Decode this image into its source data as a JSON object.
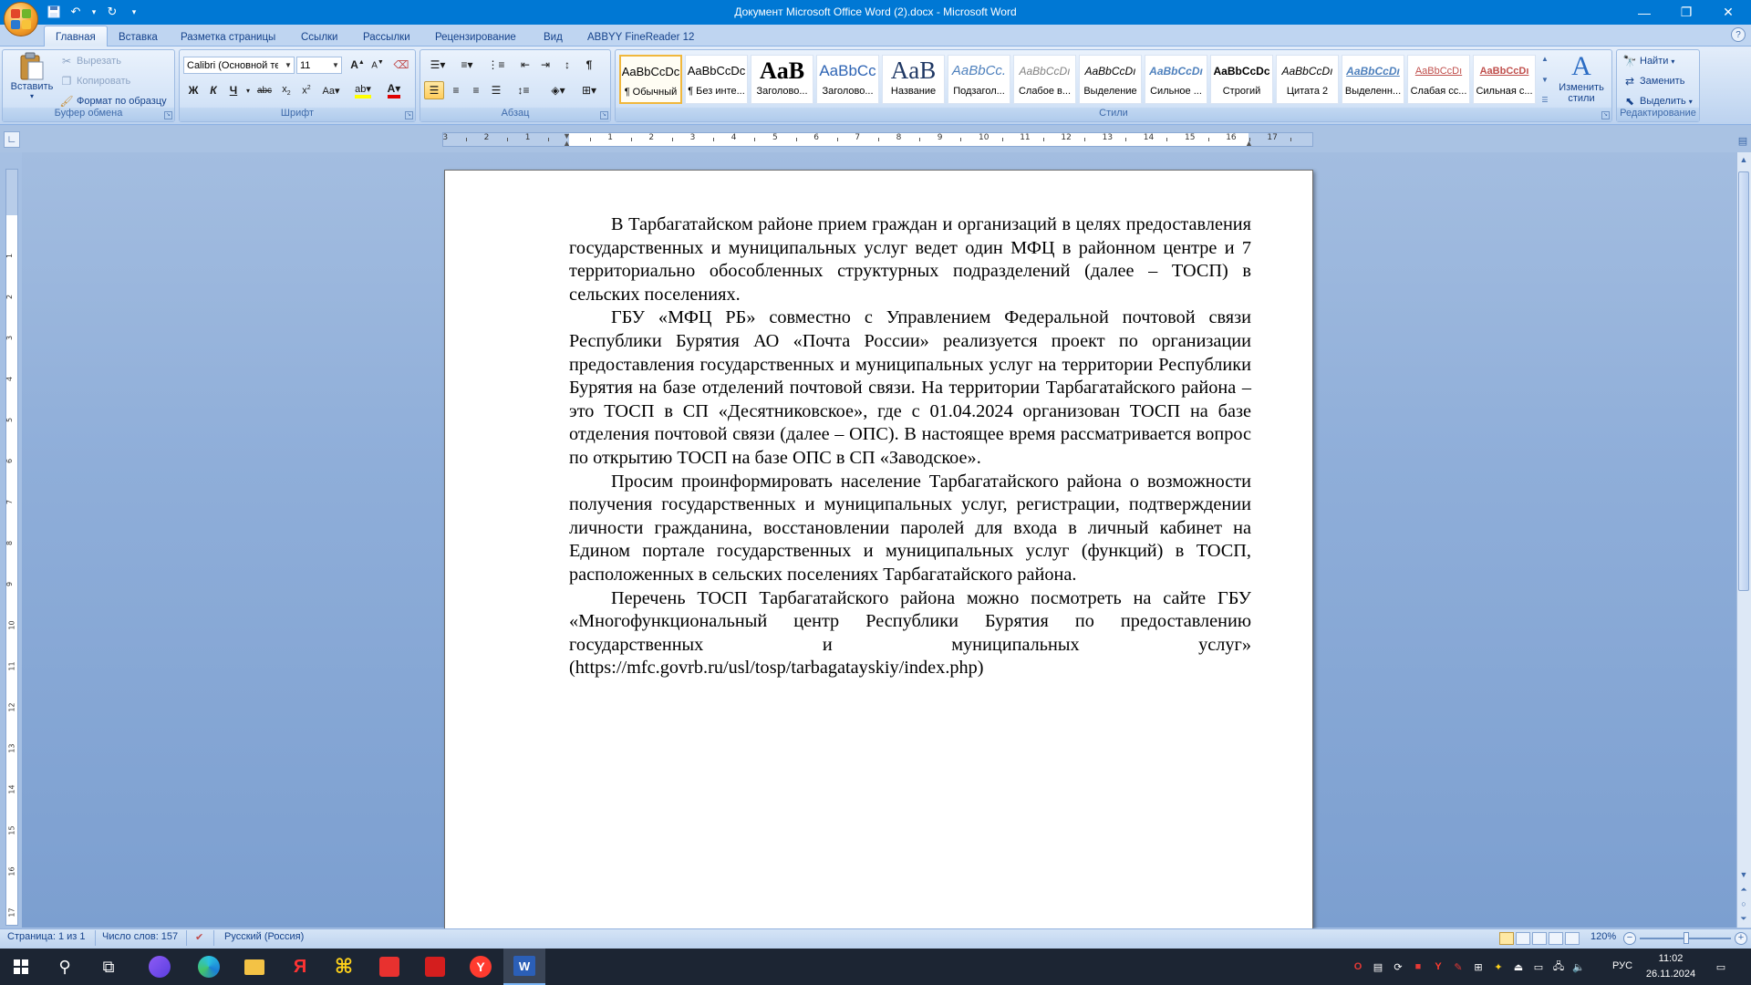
{
  "window": {
    "title": "Документ Microsoft Office Word (2).docx - Microsoft Word",
    "min_icon": "minimize-icon",
    "max_icon": "restore-icon",
    "close_icon": "close-icon"
  },
  "ribbon": {
    "tabs": [
      "Главная",
      "Вставка",
      "Разметка страницы",
      "Ссылки",
      "Рассылки",
      "Рецензирование",
      "Вид",
      "ABBYY FineReader 12"
    ],
    "active_tab": "Главная",
    "clipboard": {
      "paste": "Вставить",
      "cut": "Вырезать",
      "copy": "Копировать",
      "format_painter": "Формат по образцу",
      "title": "Буфер обмена"
    },
    "font": {
      "name": "Calibri (Основной те",
      "size": "11",
      "title": "Шрифт"
    },
    "paragraph": {
      "title": "Абзац"
    },
    "styles": {
      "title": "Стили",
      "items": [
        {
          "preview": "AaBbCcDc",
          "name": "¶ Обычный"
        },
        {
          "preview": "AaBbCcDc",
          "name": "¶ Без инте..."
        },
        {
          "preview": "AaB",
          "name": "Заголово..."
        },
        {
          "preview": "AaBbCc",
          "name": "Заголово..."
        },
        {
          "preview": "AaB",
          "name": "Название"
        },
        {
          "preview": "AaBbCc.",
          "name": "Подзагол..."
        },
        {
          "preview": "AaBbCcDı",
          "name": "Слабое в..."
        },
        {
          "preview": "AaBbCcDı",
          "name": "Выделение"
        },
        {
          "preview": "AaBbCcDı",
          "name": "Сильное ..."
        },
        {
          "preview": "AaBbCcDc",
          "name": "Строгий"
        },
        {
          "preview": "AaBbCcDı",
          "name": "Цитата 2"
        },
        {
          "preview": "AaBbCcDı",
          "name": "Выделенн..."
        },
        {
          "preview": "AaBbCcDı",
          "name": "Слабая сс..."
        },
        {
          "preview": "AaBbCcDı",
          "name": "Сильная с..."
        }
      ],
      "change_styles": "Изменить стили"
    },
    "editing": {
      "find": "Найти",
      "replace": "Заменить",
      "select": "Выделить",
      "title": "Редактирование"
    }
  },
  "ruler": {
    "h_left": [
      "3",
      "2",
      "1"
    ],
    "h_right": [
      "1",
      "2",
      "3",
      "4",
      "5",
      "6",
      "7",
      "8",
      "9",
      "10",
      "11",
      "12",
      "13",
      "14",
      "15",
      "16",
      "17"
    ],
    "v": [
      "1",
      "2",
      "3",
      "4",
      "5",
      "6",
      "7",
      "8",
      "9",
      "10",
      "11",
      "12",
      "13",
      "14",
      "15",
      "16",
      "17"
    ]
  },
  "document": {
    "paragraphs": [
      "В Тарбагатайском районе прием граждан и организаций в целях предоставления государственных и муниципальных услуг ведет один МФЦ в районном центре и 7 территориально обособленных структурных подразделений (далее – ТОСП) в сельских поселениях.",
      "ГБУ «МФЦ РБ» совместно с Управлением Федеральной почтовой связи Республики Бурятия АО «Почта России» реализуется проект по организации предоставления государственных и муниципальных услуг на территории Республики Бурятия на базе отделений почтовой связи. На территории Тарбагатайского района – это ТОСП в СП «Десятниковское», где с 01.04.2024 организован ТОСП на базе отделения почтовой связи (далее – ОПС). В настоящее время рассматривается вопрос по открытию ТОСП на базе ОПС в СП «Заводское».",
      "Просим проинформировать население Тарбагатайского района о возможности получения государственных и муниципальных услуг, регистрации, подтверждении личности гражданина, восстановлении паролей для входа в личный кабинет на Едином портале государственных и муниципальных услуг (функций) в ТОСП, расположенных в сельских поселениях Тарбагатайского района.",
      "Перечень ТОСП Тарбагатайского района можно посмотреть на сайте ГБУ «Многофункциональный центр Республики Бурятия по предоставлению государственных и муниципальных услуг» (https://mfc.govrb.ru/usl/tosp/tarbagatayskiy/index.php)"
    ]
  },
  "status": {
    "page": "Страница: 1 из 1",
    "words": "Число слов: 157",
    "language": "Русский (Россия)",
    "zoom": "120%"
  },
  "taskbar": {
    "lang": "РУС",
    "time": "11:02",
    "date": "26.11.2024"
  },
  "colors": {
    "accent": "#0078d4",
    "ribbon": "#dbe8f7",
    "doc_bg": "#8faed9"
  }
}
